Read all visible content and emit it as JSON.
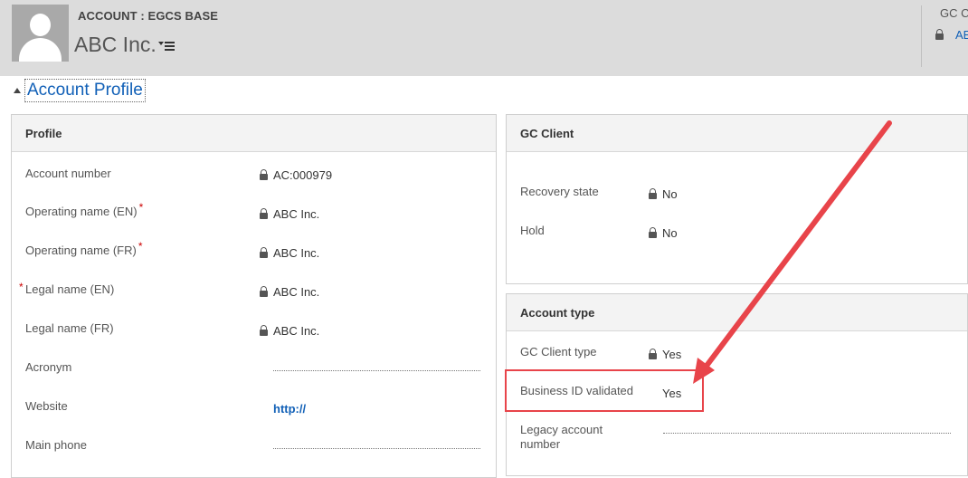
{
  "header": {
    "entity_label": "ACCOUNT : EGCS BASE",
    "record_title": "ABC Inc.",
    "right_label": "GC C",
    "right_link": "AE"
  },
  "section": {
    "title": "Account Profile"
  },
  "profile": {
    "title": "Profile",
    "fields": [
      {
        "label": "Account number",
        "value": "AC:000979",
        "locked": true
      },
      {
        "label": "Operating name (EN)",
        "value": "ABC Inc.",
        "locked": true,
        "required": true
      },
      {
        "label": "Operating name (FR)",
        "value": "ABC Inc.",
        "locked": true,
        "required": true
      },
      {
        "label": "Legal name (EN)",
        "value": "ABC Inc.",
        "locked": true,
        "required": true
      },
      {
        "label": "Legal name (FR)",
        "value": "ABC Inc.",
        "locked": true
      },
      {
        "label": "Acronym",
        "value": ""
      },
      {
        "label": "Website",
        "value": "http://"
      },
      {
        "label": "Main phone",
        "value": ""
      }
    ]
  },
  "gc_client": {
    "title": "GC Client",
    "fields": [
      {
        "label": "Recovery state",
        "value": "No",
        "locked": true
      },
      {
        "label": "Hold",
        "value": "No",
        "locked": true
      }
    ]
  },
  "account_type": {
    "title": "Account type",
    "fields": [
      {
        "label": "GC Client type",
        "value": "Yes",
        "locked": true
      },
      {
        "label": "Business ID validated",
        "value": "Yes"
      },
      {
        "label": "Legacy account",
        "label2": "number",
        "value": ""
      }
    ]
  },
  "colors": {
    "accent": "#1160b7",
    "annotation": "#e8444a",
    "required": "#cc0000"
  }
}
